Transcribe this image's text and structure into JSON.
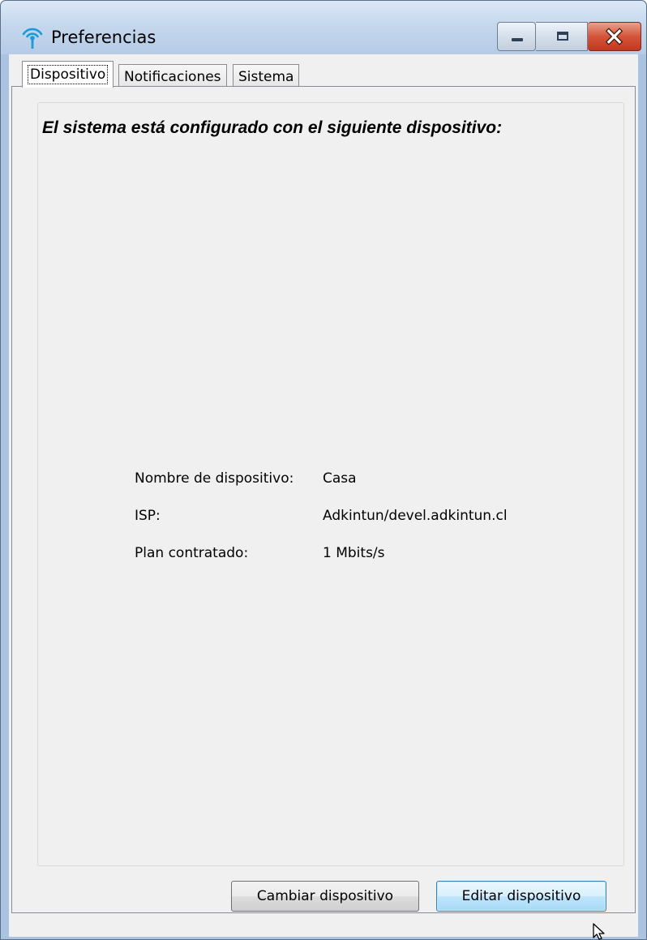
{
  "window": {
    "title": "Preferencias",
    "icon": "wifi-antenna-icon",
    "controls": [
      "minimize-icon",
      "maximize-icon",
      "close-icon"
    ]
  },
  "tabs": [
    {
      "label": "Dispositivo",
      "active": true
    },
    {
      "label": "Notificaciones",
      "active": false
    },
    {
      "label": "Sistema",
      "active": false
    }
  ],
  "device": {
    "heading": "El sistema está configurado con el siguiente dispositivo:",
    "fields": [
      {
        "label": "Nombre de dispositivo:",
        "value": "Casa"
      },
      {
        "label": "ISP:",
        "value": "Adkintun/devel.adkintun.cl"
      },
      {
        "label": "Plan contratado:",
        "value": "1 Mbits/s"
      }
    ]
  },
  "buttons": {
    "change": "Cambiar dispositivo",
    "edit": "Editar dispositivo"
  },
  "colors": {
    "titlebar": "#c3d6ec",
    "close_button": "#c3381e",
    "icon": "#1a9bd7",
    "focused_button_border": "#3c7fb1"
  }
}
